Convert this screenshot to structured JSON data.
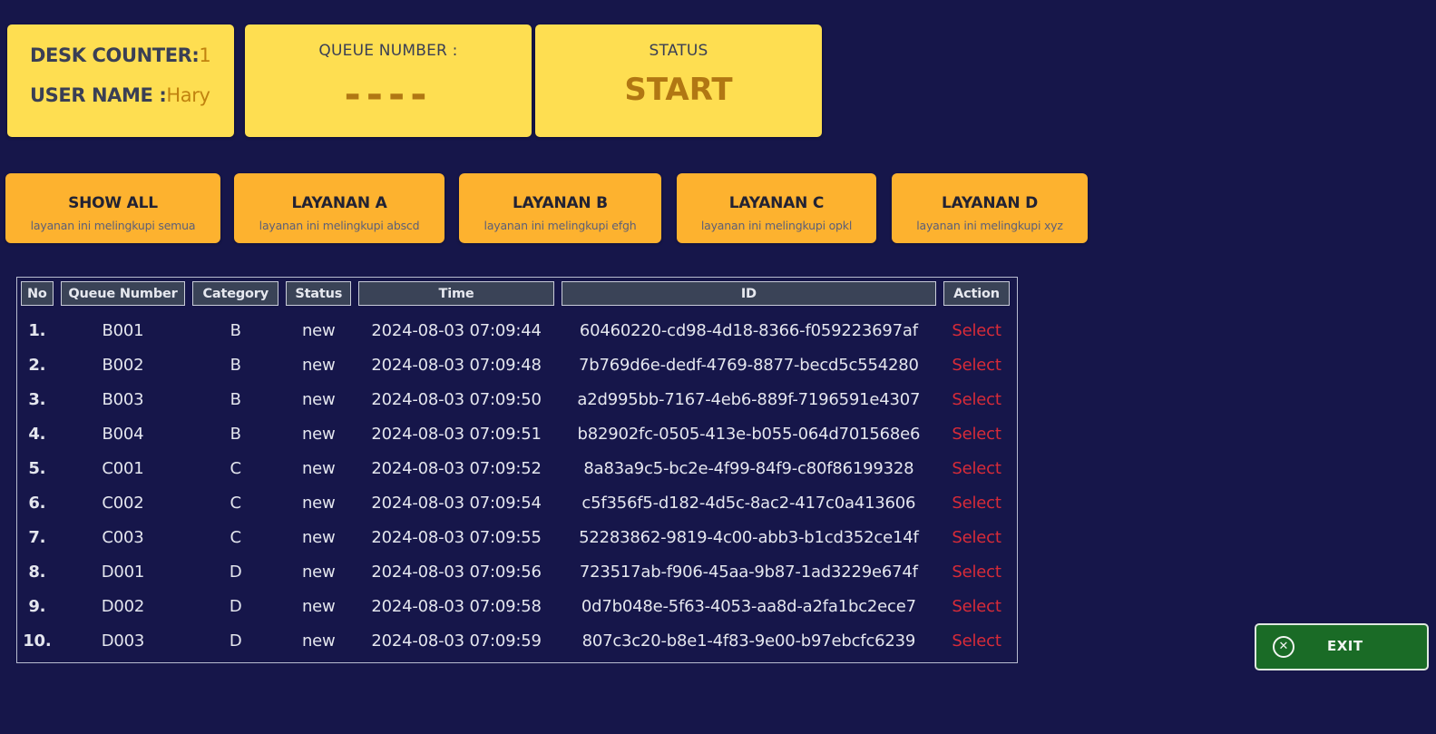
{
  "header": {
    "desk_label": "DESK COUNTER:",
    "desk_value": "1",
    "user_label": "USER NAME :",
    "user_value": "Hary",
    "queue_label": "QUEUE NUMBER :",
    "queue_value": "----",
    "status_label": "STATUS",
    "status_value": "START"
  },
  "filters": [
    {
      "title": "SHOW ALL",
      "subtitle": "layanan ini melingkupi semua"
    },
    {
      "title": "LAYANAN A",
      "subtitle": "layanan ini melingkupi abscd"
    },
    {
      "title": "LAYANAN B",
      "subtitle": "layanan ini melingkupi efgh"
    },
    {
      "title": "LAYANAN C",
      "subtitle": "layanan ini melingkupi opkl"
    },
    {
      "title": "LAYANAN D",
      "subtitle": "layanan ini melingkupi xyz"
    }
  ],
  "table": {
    "headers": [
      "No",
      "Queue Number",
      "Category",
      "Status",
      "Time",
      "ID",
      "Action"
    ],
    "rows": [
      {
        "no": "1.",
        "queue": "B001",
        "category": "B",
        "status": "new",
        "time": "2024-08-03 07:09:44",
        "id": "60460220-cd98-4d18-8366-f059223697af",
        "action": "Select"
      },
      {
        "no": "2.",
        "queue": "B002",
        "category": "B",
        "status": "new",
        "time": "2024-08-03 07:09:48",
        "id": "7b769d6e-dedf-4769-8877-becd5c554280",
        "action": "Select"
      },
      {
        "no": "3.",
        "queue": "B003",
        "category": "B",
        "status": "new",
        "time": "2024-08-03 07:09:50",
        "id": "a2d995bb-7167-4eb6-889f-7196591e4307",
        "action": "Select"
      },
      {
        "no": "4.",
        "queue": "B004",
        "category": "B",
        "status": "new",
        "time": "2024-08-03 07:09:51",
        "id": "b82902fc-0505-413e-b055-064d701568e6",
        "action": "Select"
      },
      {
        "no": "5.",
        "queue": "C001",
        "category": "C",
        "status": "new",
        "time": "2024-08-03 07:09:52",
        "id": "8a83a9c5-bc2e-4f99-84f9-c80f86199328",
        "action": "Select"
      },
      {
        "no": "6.",
        "queue": "C002",
        "category": "C",
        "status": "new",
        "time": "2024-08-03 07:09:54",
        "id": "c5f356f5-d182-4d5c-8ac2-417c0a413606",
        "action": "Select"
      },
      {
        "no": "7.",
        "queue": "C003",
        "category": "C",
        "status": "new",
        "time": "2024-08-03 07:09:55",
        "id": "52283862-9819-4c00-abb3-b1cd352ce14f",
        "action": "Select"
      },
      {
        "no": "8.",
        "queue": "D001",
        "category": "D",
        "status": "new",
        "time": "2024-08-03 07:09:56",
        "id": "723517ab-f906-45aa-9b87-1ad3229e674f",
        "action": "Select"
      },
      {
        "no": "9.",
        "queue": "D002",
        "category": "D",
        "status": "new",
        "time": "2024-08-03 07:09:58",
        "id": "0d7b048e-5f63-4053-aa8d-a2fa1bc2ece7",
        "action": "Select"
      },
      {
        "no": "10.",
        "queue": "D003",
        "category": "D",
        "status": "new",
        "time": "2024-08-03 07:09:59",
        "id": "807c3c20-b8e1-4f83-9e00-b97ebcfc6239",
        "action": "Select"
      }
    ]
  },
  "exit": {
    "label": "EXIT",
    "icon": "close-circle-icon"
  },
  "colors": {
    "background": "#16164a",
    "card": "#fede51",
    "filter_button": "#fdb22f",
    "accent_text": "#b17713",
    "select_link": "#d82b38",
    "exit_button": "#1a6b26"
  }
}
